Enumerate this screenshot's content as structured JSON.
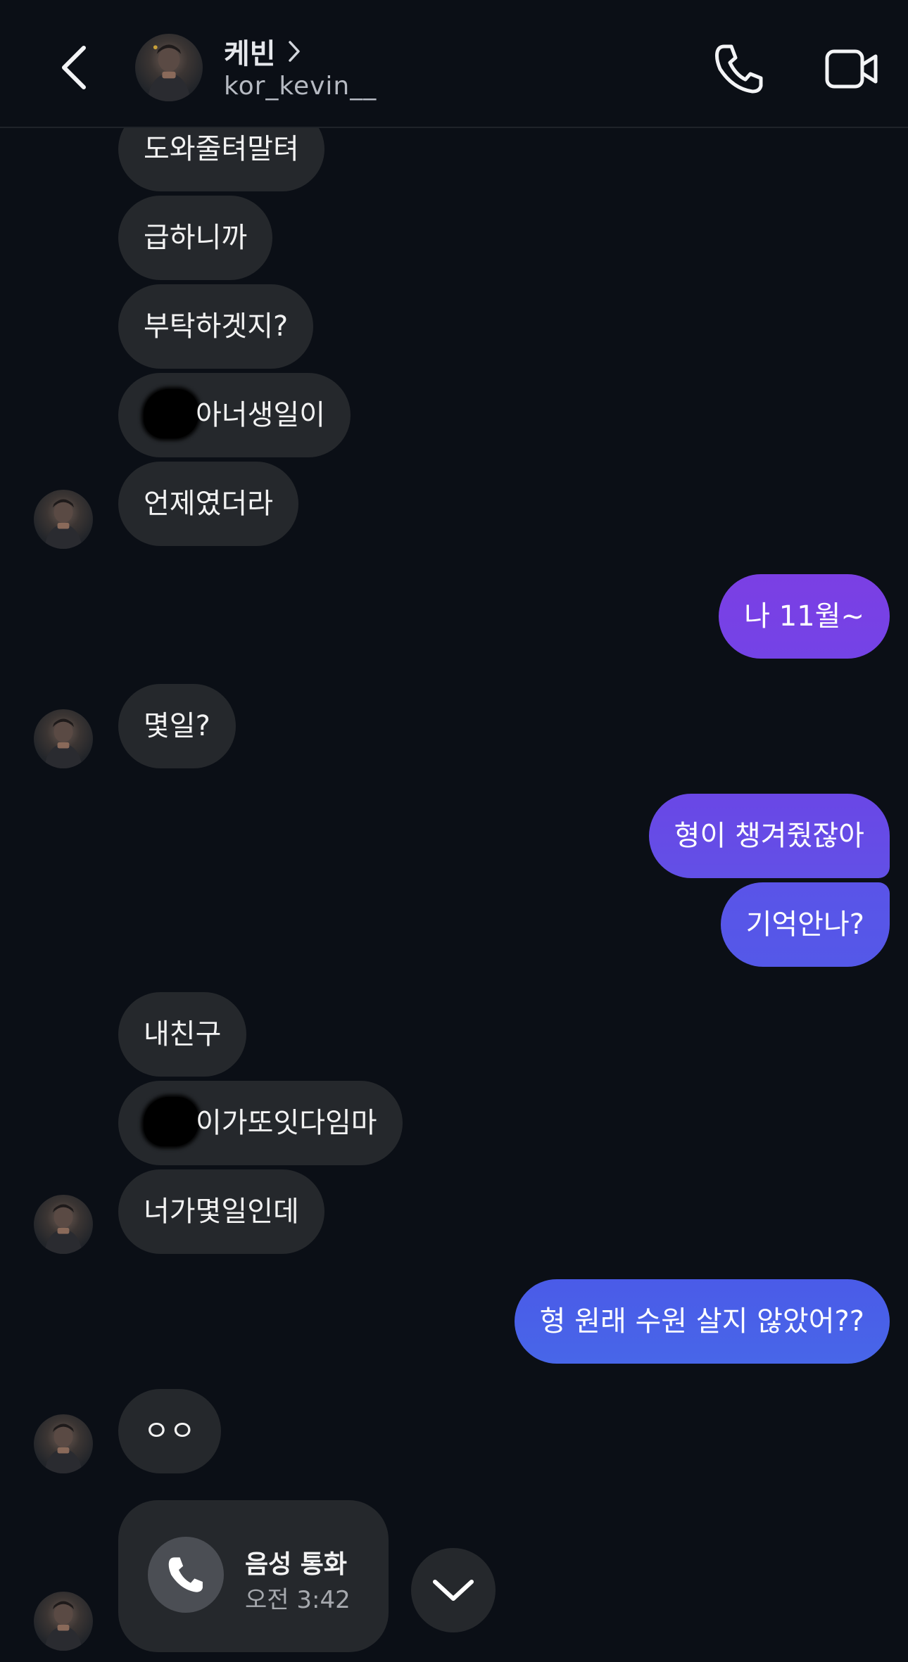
{
  "header": {
    "name": "케빈",
    "username": "kor_kevin__"
  },
  "messages": [
    {
      "id": "m1",
      "side": "in",
      "text": "도와줄텨말텨"
    },
    {
      "id": "m2",
      "side": "in",
      "text": "급하니까"
    },
    {
      "id": "m3",
      "side": "in",
      "text": "부탁하겟지?"
    },
    {
      "id": "m4",
      "side": "in",
      "text": "아너생일이",
      "redacted_prefix": true
    },
    {
      "id": "m5",
      "side": "in",
      "text": "언제였더라"
    },
    {
      "id": "m6",
      "side": "out",
      "text": "나 11월~"
    },
    {
      "id": "m7",
      "side": "in",
      "text": "몇일?"
    },
    {
      "id": "m8",
      "side": "out",
      "text": "형이 챙겨줬잖아"
    },
    {
      "id": "m9",
      "side": "out",
      "text": "기억안나?"
    },
    {
      "id": "m10",
      "side": "in",
      "text": "내친구"
    },
    {
      "id": "m11",
      "side": "in",
      "text": "이가또잇다임마",
      "redacted_prefix": true
    },
    {
      "id": "m12",
      "side": "in",
      "text": "너가몇일인데"
    },
    {
      "id": "m13",
      "side": "out",
      "text": "형 원래 수원 살지 않았어??"
    },
    {
      "id": "m14",
      "side": "in",
      "text": "ㅇㅇ"
    }
  ],
  "call": {
    "title": "음성 통화",
    "time": "오전 3:42"
  },
  "colors": {
    "background": "#0b0f16",
    "incoming_bubble": "#25282c",
    "outgoing_gradient_top": "#7b3fe4",
    "outgoing_gradient_bottom": "#4a63e8"
  },
  "icons": {
    "back": "chevron-left-icon",
    "profile": "chevron-right-icon",
    "call": "phone-icon",
    "video": "video-camera-icon",
    "scroll": "chevron-down-icon"
  }
}
